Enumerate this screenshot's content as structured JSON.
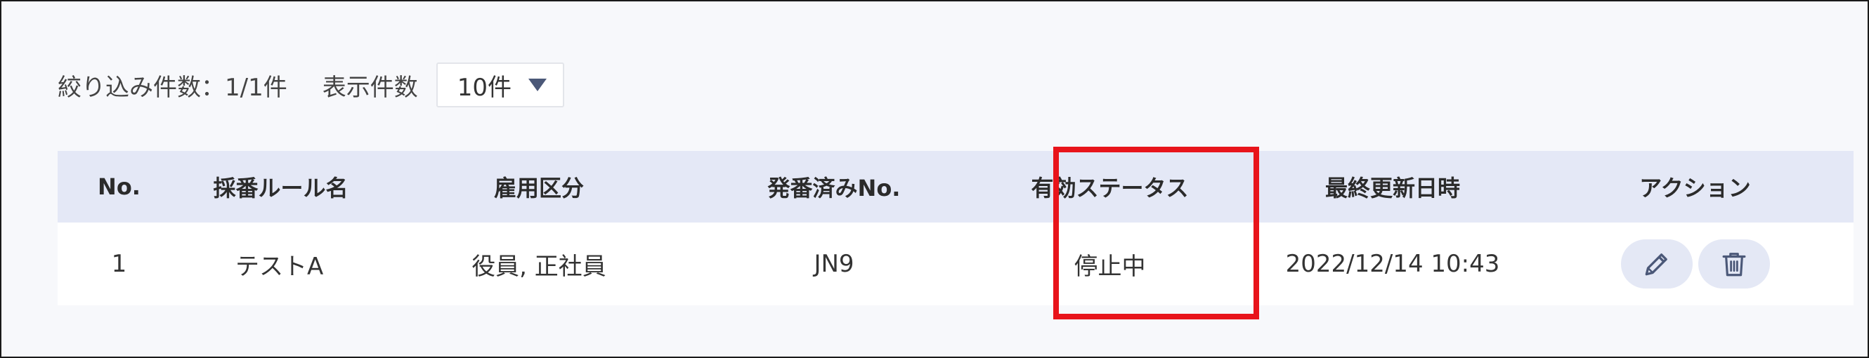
{
  "filter": {
    "result_label": "絞り込み件数：1/1件",
    "display_label": "表示件数",
    "per_page_value": "10件"
  },
  "table": {
    "headers": [
      "No.",
      "採番ルール名",
      "雇用区分",
      "発番済みNo.",
      "有効ステータス",
      "最終更新日時",
      "アクション"
    ],
    "rows": [
      {
        "no": "1",
        "rule_name": "テストA",
        "employment_type": "役員, 正社員",
        "issued_no": "JN9",
        "status": "停止中",
        "updated_at": "2022/12/14 10:43"
      }
    ]
  },
  "icons": {
    "edit": "pencil-icon",
    "delete": "trash-icon"
  },
  "colors": {
    "header_bg": "#e4e8f6",
    "action_button_bg": "#e4e8f5",
    "highlight": "#e8141b"
  }
}
